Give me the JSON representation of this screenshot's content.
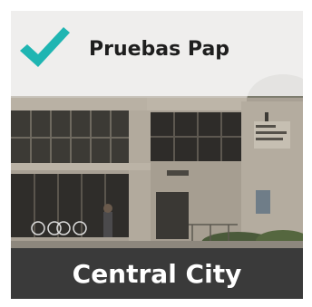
{
  "card": {
    "title": "Pruebas Pap",
    "location": "Central City",
    "photo_alt": "building-photo",
    "check_icon": "checkmark-icon"
  },
  "colors": {
    "accent": "#1fb5b2",
    "top_banner": "#f4f4f4",
    "bottom_banner": "#3a3a3a",
    "title_text": "#1e1e1e",
    "location_text": "#ffffff"
  }
}
